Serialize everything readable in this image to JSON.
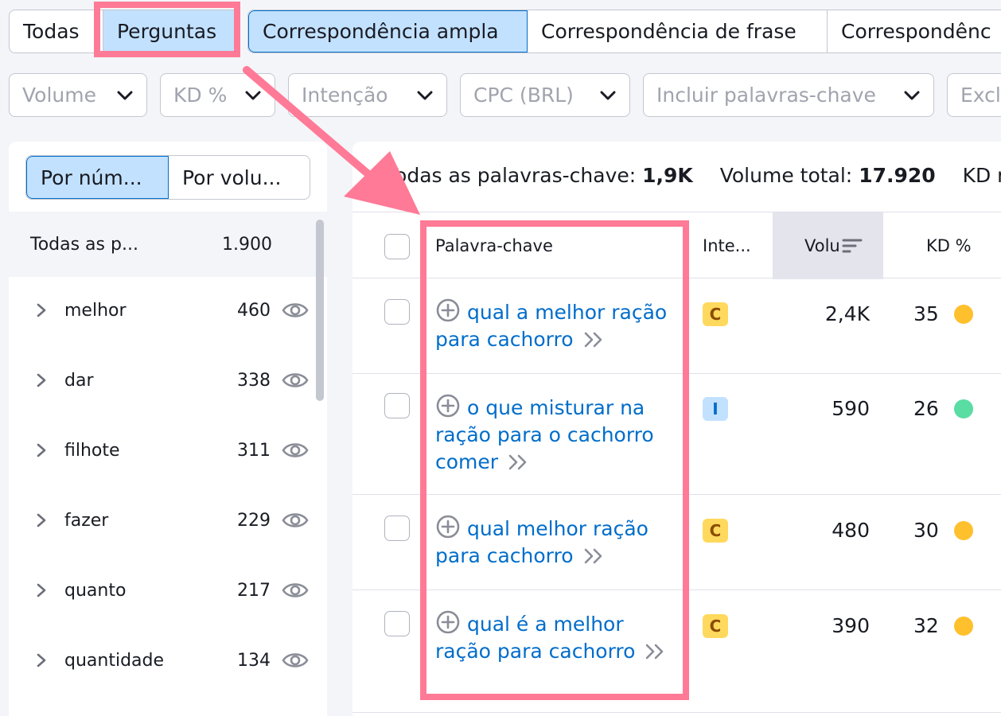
{
  "search_tabs": {
    "type_tabs": [
      {
        "label": "Todas",
        "active": false
      },
      {
        "label": "Perguntas",
        "active": true
      }
    ],
    "match_tabs": [
      {
        "label": "Correspondência ampla",
        "active": true
      },
      {
        "label": "Correspondência de frase",
        "active": false
      },
      {
        "label": "Correspondênc",
        "active": false
      }
    ]
  },
  "filters": {
    "volume": "Volume",
    "kd": "KD %",
    "intent": "Intenção",
    "cpc": "CPC (BRL)",
    "include": "Incluir palavras-chave",
    "exclude": "Excl"
  },
  "sidebar": {
    "toggle": {
      "by_number": "Por núm...",
      "by_volume": "Por volu..."
    },
    "all": {
      "label": "Todas as p...",
      "count": "1.900"
    },
    "groups": [
      {
        "label": "melhor",
        "count": "460"
      },
      {
        "label": "dar",
        "count": "338"
      },
      {
        "label": "filhote",
        "count": "311"
      },
      {
        "label": "fazer",
        "count": "229"
      },
      {
        "label": "quanto",
        "count": "217"
      },
      {
        "label": "quantidade",
        "count": "134"
      }
    ]
  },
  "summary": {
    "all_label": "Todas as palavras-chave:",
    "all_value": "1,9K",
    "volume_label": "Volume total:",
    "volume_value": "17.920",
    "kd_label": "KD m"
  },
  "table": {
    "headers": {
      "keyword": "Palavra-chave",
      "intent": "Inte...",
      "volume": "Volu",
      "kd": "KD %"
    },
    "rows": [
      {
        "keyword": "qual a melhor ração para cachorro",
        "intent": "C",
        "volume": "2,4K",
        "kd": "35",
        "kd_color": "#ffc02d"
      },
      {
        "keyword": "o que misturar na ração para o cachorro comer",
        "intent": "I",
        "volume": "590",
        "kd": "26",
        "kd_color": "#59dda3"
      },
      {
        "keyword": "qual melhor ração para cachorro",
        "intent": "C",
        "volume": "480",
        "kd": "30",
        "kd_color": "#ffc02d"
      },
      {
        "keyword": "qual é a melhor ração para cachorro",
        "intent": "C",
        "volume": "390",
        "kd": "32",
        "kd_color": "#ffc02d"
      }
    ]
  },
  "colors": {
    "accent": "#006dca",
    "highlight": "#ff7a96",
    "active_bg": "#c2e1ff"
  }
}
